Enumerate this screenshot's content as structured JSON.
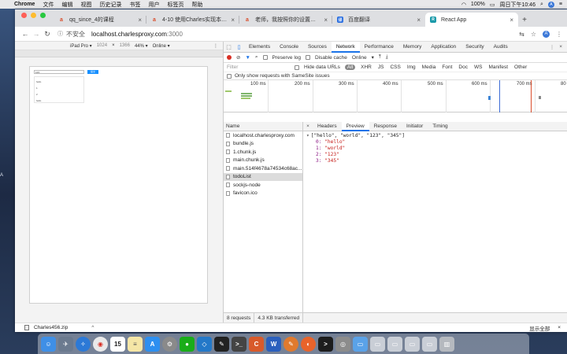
{
  "menubar": {
    "app_name": "Chrome",
    "items": [
      "文件",
      "编辑",
      "视图",
      "历史记录",
      "书签",
      "用户",
      "标签页",
      "帮助"
    ],
    "battery": "100%",
    "clock": "周日下午10:46",
    "avatar_letter": "A"
  },
  "tabs": [
    {
      "title": "qq_since_4的课程",
      "favicon": "a",
      "active": false
    },
    {
      "title": "4-10 使用Charles实现本地数据mock",
      "favicon": "a",
      "active": false
    },
    {
      "title": "老师，我按照你的设置之后，还是",
      "favicon": "a",
      "active": false
    },
    {
      "title": "百度翻译",
      "favicon": "译",
      "active": false
    },
    {
      "title": "React App",
      "favicon": "R",
      "active": true
    }
  ],
  "omnibox": {
    "security": "不安全",
    "host": "localhost.charlesproxy.com",
    "port": ":3000"
  },
  "device_toolbar": {
    "device": "iPad Pro ▾",
    "width": "1024",
    "times": "×",
    "height": "1366",
    "zoom": "44% ▾",
    "network": "Online ▾"
  },
  "app": {
    "input_value": "123",
    "button_label": "提交",
    "list_items": [
      "hello",
      "1",
      "2",
      "hello"
    ]
  },
  "devtools": {
    "panels": [
      "Elements",
      "Console",
      "Sources",
      "Network",
      "Performance",
      "Memory",
      "Application",
      "Security",
      "Audits"
    ],
    "active_panel": "Network",
    "preserve_log": "Preserve log",
    "disable_cache": "Disable cache",
    "throttle": "Online",
    "filter_placeholder": "Filter",
    "hide_data_urls": "Hide data URLs",
    "types": [
      "All",
      "XHR",
      "JS",
      "CSS",
      "Img",
      "Media",
      "Font",
      "Doc",
      "WS",
      "Manifest",
      "Other"
    ],
    "same_site": "Only show requests with SameSite issues",
    "timeline_ticks": [
      "100 ms",
      "200 ms",
      "300 ms",
      "400 ms",
      "500 ms",
      "600 ms",
      "700 ms",
      "80"
    ],
    "name_header": "Name",
    "requests": [
      {
        "name": "localhost.charlesproxy.com",
        "selected": false
      },
      {
        "name": "bundle.js",
        "selected": false
      },
      {
        "name": "1.chunk.js",
        "selected": false
      },
      {
        "name": "main.chunk.js",
        "selected": false
      },
      {
        "name": "main.514f4678a74534c68ac...",
        "selected": false
      },
      {
        "name": "todoList",
        "selected": true
      },
      {
        "name": "sockjs-node",
        "selected": false
      },
      {
        "name": "favicon.ico",
        "selected": false
      }
    ],
    "detail_tabs": [
      "Headers",
      "Preview",
      "Response",
      "Initiator",
      "Timing"
    ],
    "active_detail_tab": "Preview",
    "preview": {
      "summary": "[\"hello\", \"world\", \"123\", \"345\"]",
      "entries": [
        {
          "index": "0:",
          "value": "\"hello\""
        },
        {
          "index": "1:",
          "value": "\"world\""
        },
        {
          "index": "2:",
          "value": "\"123\""
        },
        {
          "index": "3:",
          "value": "\"345\""
        }
      ]
    },
    "status_requests": "8 requests",
    "status_transferred": "4.3 KB transferred"
  },
  "download": {
    "file": "Charles456.zip",
    "show_all": "显示全部"
  },
  "dock": {
    "calendar_day": "15"
  },
  "colors": {
    "accent": "#1a73e8",
    "app_button": "#1890ff",
    "record": "#d93025"
  }
}
